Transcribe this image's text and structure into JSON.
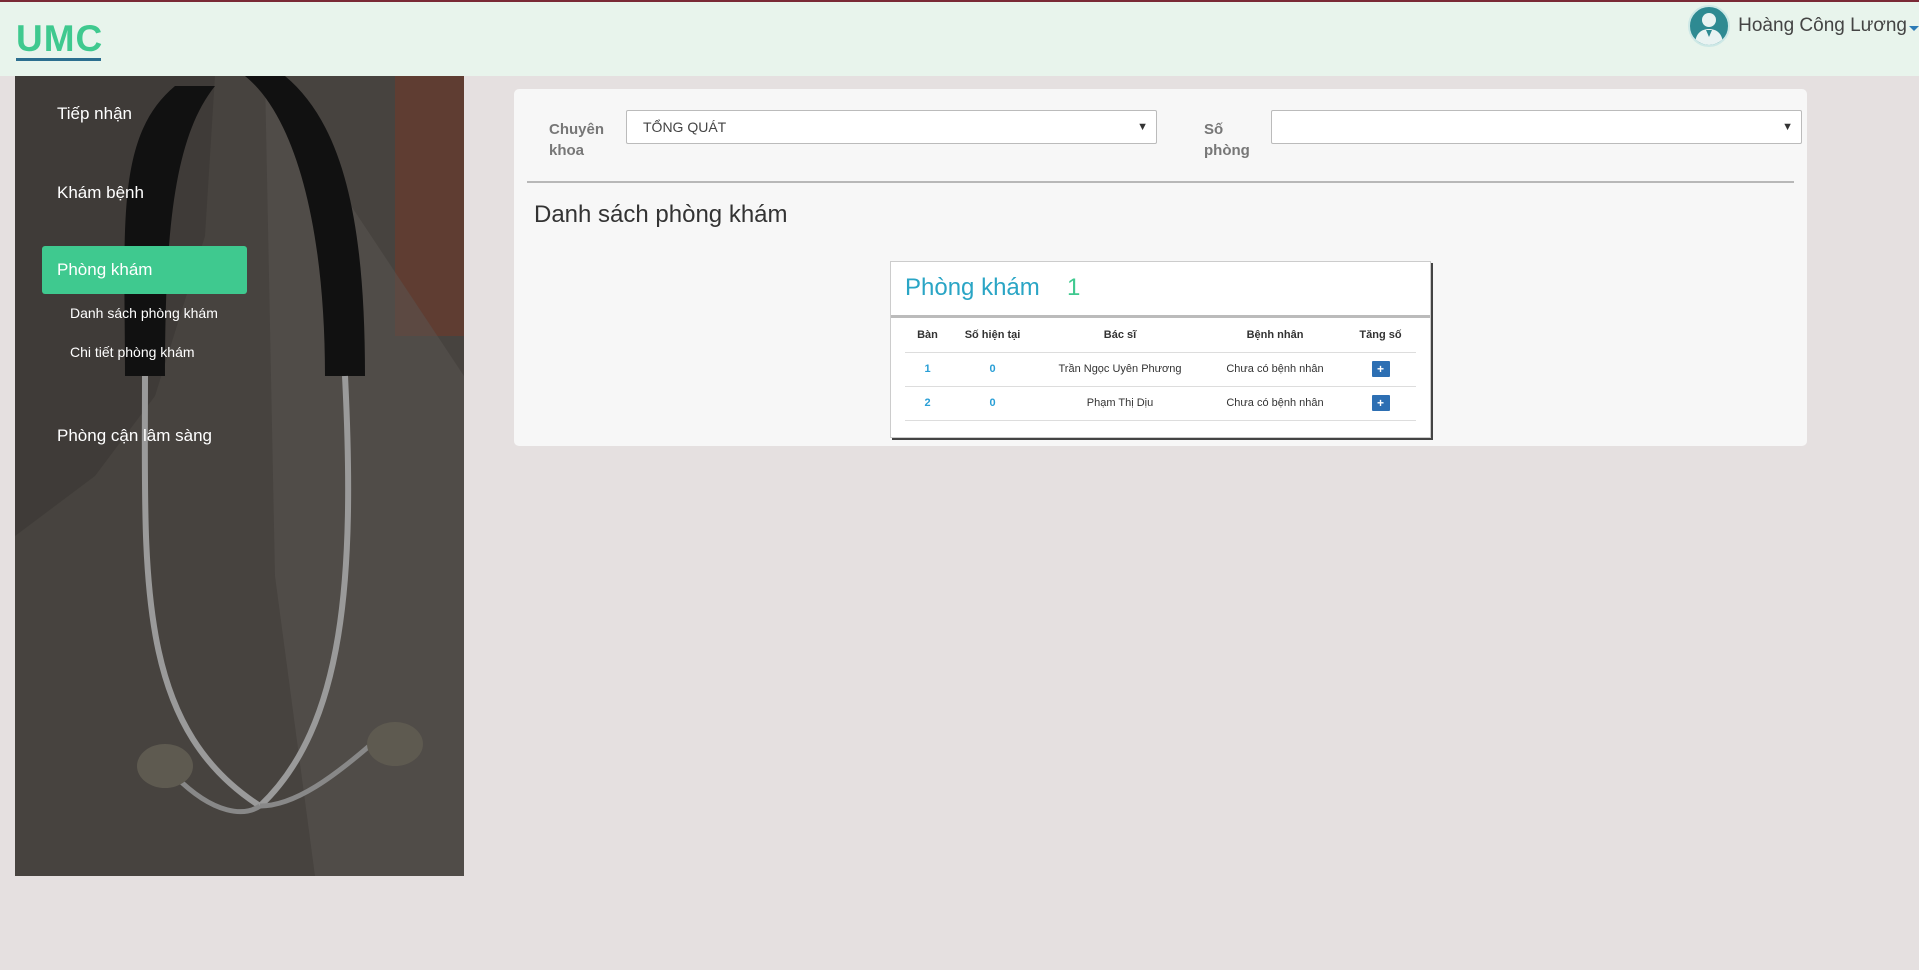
{
  "app": {
    "logo": "UMC"
  },
  "user": {
    "name": "Hoàng Công Lương"
  },
  "sidebar": {
    "items": [
      {
        "label": "Tiếp nhận"
      },
      {
        "label": "Khám bệnh"
      },
      {
        "label": "Phòng khám",
        "active": true
      },
      {
        "label": "Phòng cận lâm sàng"
      }
    ],
    "sub_items": [
      {
        "label": "Danh sách phòng khám"
      },
      {
        "label": "Chi tiết phòng khám"
      }
    ]
  },
  "filters": {
    "specialty_label_1": "Chuyên",
    "specialty_label_2": "khoa",
    "specialty_value": "TỔNG QUÁT",
    "room_label_1": "Số",
    "room_label_2": "phòng",
    "room_value": ""
  },
  "main": {
    "section_title": "Danh sách phòng khám"
  },
  "room_card": {
    "title": "Phòng khám",
    "number": "1",
    "columns": [
      "Bàn",
      "Số hiện tại",
      "Bác sĩ",
      "Bệnh nhân",
      "Tăng số"
    ],
    "rows": [
      {
        "ban": "1",
        "current": "0",
        "doctor": "Trần Ngọc Uyên Phương",
        "patient": "Chưa có bệnh nhân",
        "action": "+"
      },
      {
        "ban": "2",
        "current": "0",
        "doctor": "Phạm Thị Dịu",
        "patient": "Chưa có bệnh nhân",
        "action": "+"
      }
    ]
  },
  "colors": {
    "accent": "#3fc98f",
    "link": "#2aa5c5",
    "button": "#2d6fb3"
  }
}
